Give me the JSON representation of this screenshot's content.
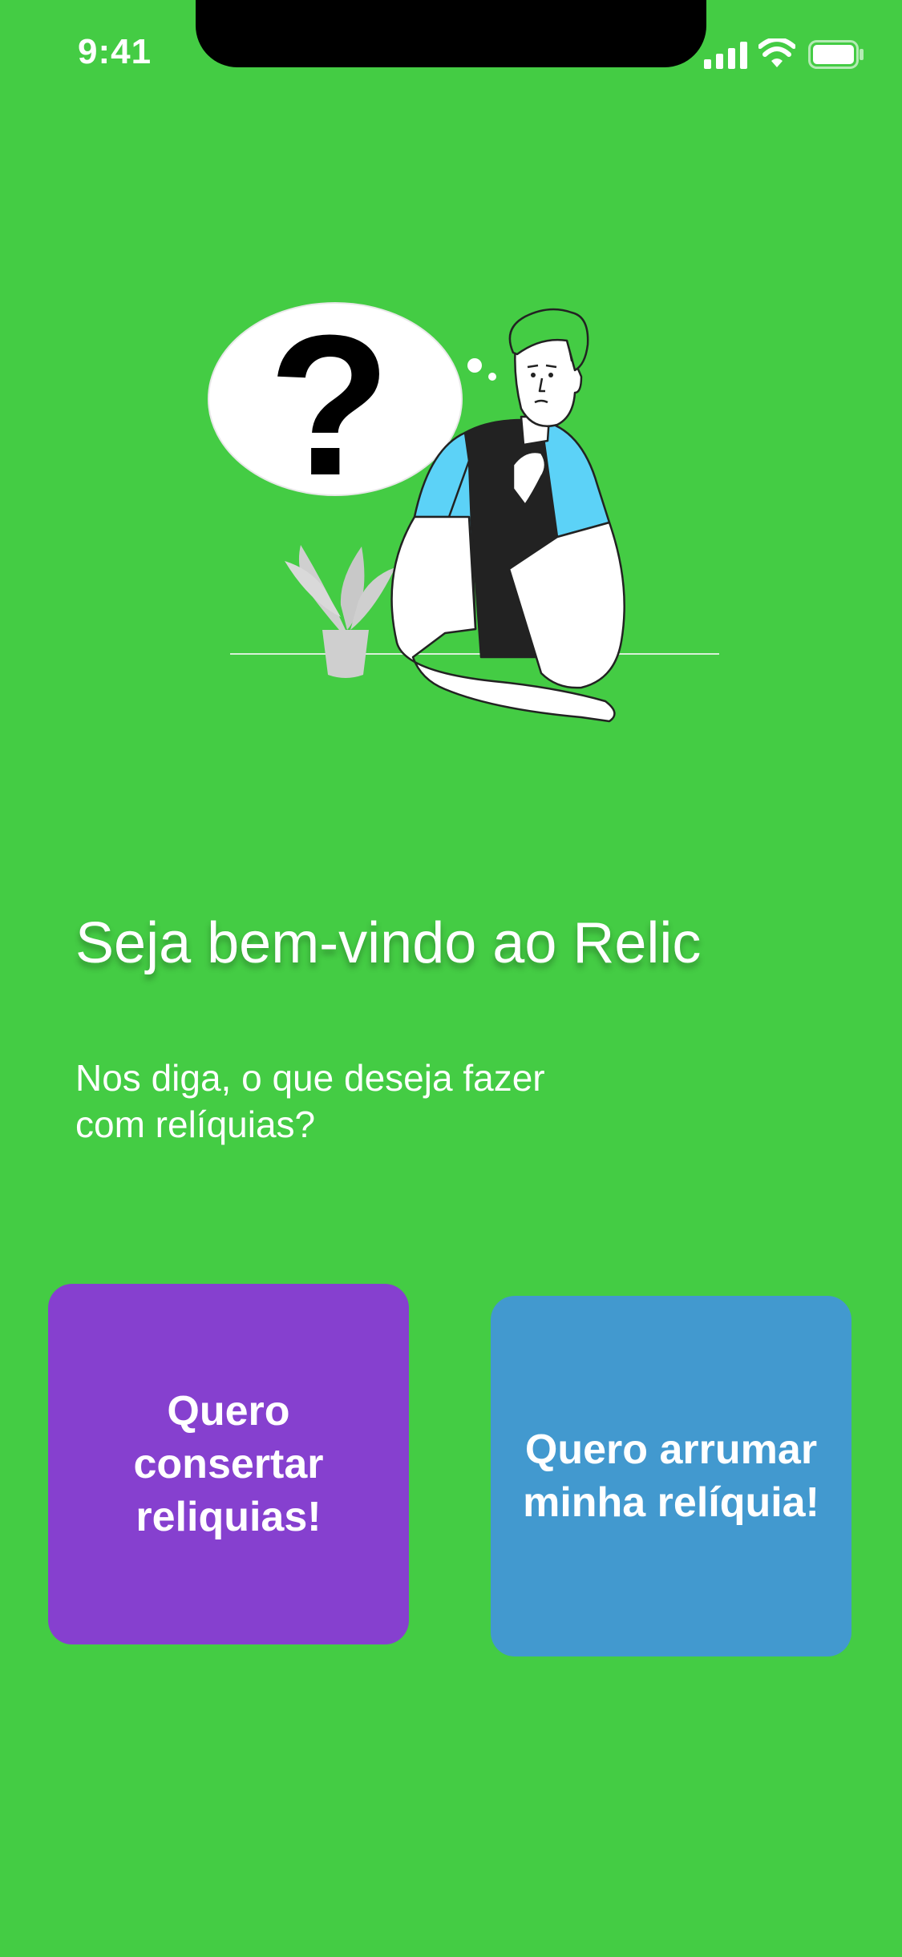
{
  "status_bar": {
    "time": "9:41",
    "icons": [
      "signal-icon",
      "wifi-icon",
      "battery-icon"
    ]
  },
  "illustration": {
    "question_mark": "?",
    "description_icon": "thinking-man-illustration"
  },
  "welcome": {
    "title": "Seja bem-vindo ao Relic",
    "subtitle_line1": "Nos diga, o que deseja fazer",
    "subtitle_line2": "com relíquias?"
  },
  "options": [
    {
      "label": "Quero consertar reliquias!",
      "color": "#8640cf"
    },
    {
      "label": "Quero arrumar minha relíquia!",
      "color": "#4299cf"
    }
  ],
  "colors": {
    "background": "#44cc44",
    "text": "#ffffff"
  }
}
